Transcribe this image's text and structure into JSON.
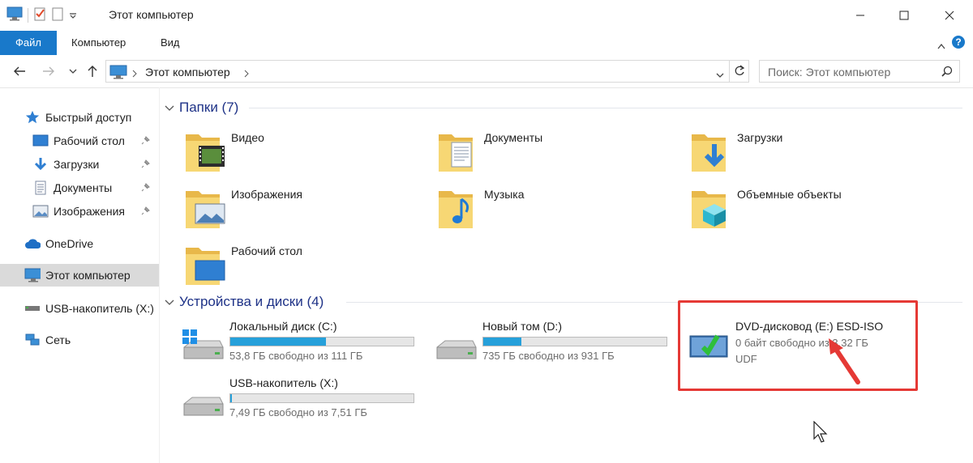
{
  "window": {
    "title": "Этот компьютер"
  },
  "ribbon": {
    "tabs": [
      "Файл",
      "Компьютер",
      "Вид"
    ]
  },
  "address": {
    "path": "Этот компьютер",
    "search_placeholder": "Поиск: Этот компьютер"
  },
  "sidebar": {
    "items": [
      {
        "label": "Быстрый доступ",
        "icon": "star-icon"
      },
      {
        "label": "Рабочий стол",
        "icon": "desktop-icon",
        "pinned": true
      },
      {
        "label": "Загрузки",
        "icon": "download-icon",
        "pinned": true
      },
      {
        "label": "Документы",
        "icon": "document-icon",
        "pinned": true
      },
      {
        "label": "Изображения",
        "icon": "pictures-icon",
        "pinned": true
      },
      {
        "label": "OneDrive",
        "icon": "cloud-icon"
      },
      {
        "label": "Этот компьютер",
        "icon": "computer-icon",
        "selected": true
      },
      {
        "label": "USB-накопитель (X:)",
        "icon": "usb-drive-icon"
      },
      {
        "label": "Сеть",
        "icon": "network-icon"
      }
    ]
  },
  "folders_group": {
    "title": "Папки (7)",
    "items": [
      {
        "label": "Видео",
        "icon": "video-folder-icon"
      },
      {
        "label": "Документы",
        "icon": "documents-folder-icon"
      },
      {
        "label": "Загрузки",
        "icon": "downloads-folder-icon"
      },
      {
        "label": "Изображения",
        "icon": "pictures-folder-icon"
      },
      {
        "label": "Музыка",
        "icon": "music-folder-icon"
      },
      {
        "label": "Объемные объекты",
        "icon": "3d-objects-folder-icon"
      },
      {
        "label": "Рабочий стол",
        "icon": "desktop-folder-icon"
      }
    ]
  },
  "devices_group": {
    "title": "Устройства и диски (4)",
    "drives": [
      {
        "name": "Локальный диск (C:)",
        "info": "53,8 ГБ свободно из 111 ГБ",
        "used_fraction": 0.52
      },
      {
        "name": "Новый том (D:)",
        "info": "735 ГБ свободно из 931 ГБ",
        "used_fraction": 0.21
      },
      {
        "name": "USB-накопитель (X:)",
        "info": "7,49 ГБ свободно из 7,51 ГБ",
        "used_fraction": 0.01
      }
    ],
    "dvd": {
      "name": "DVD-дисковод (E:) ESD-ISO",
      "info": "0 байт свободно из 3,32 ГБ",
      "fs": "UDF"
    }
  },
  "colors": {
    "accent": "#1979ca",
    "group_title": "#1e3287",
    "highlight": "#e53935",
    "bar_fill": "#26a0da"
  }
}
